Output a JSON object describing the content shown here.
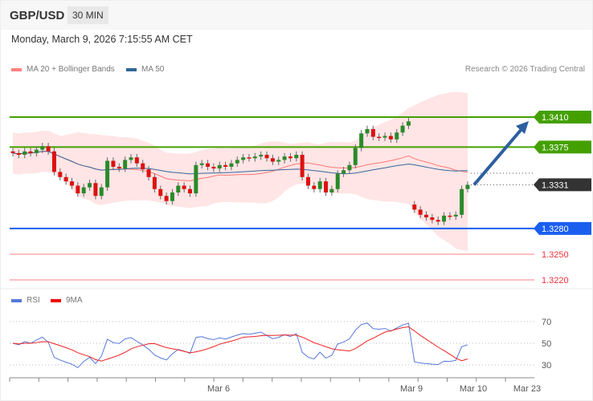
{
  "header": {
    "pair": "GBP/USD",
    "timeframe": "30 MIN",
    "datetime": "Monday, March 9, 2026 7:15:55 AM CET"
  },
  "legend": {
    "ma20": "MA 20 + Bollinger Bands",
    "ma50": "MA 50",
    "rsi": "RSI",
    "rsi_ma": "9MA"
  },
  "credit": "Research © 2026 Trading Central",
  "colors": {
    "resistance": "#44a000",
    "support": "#1a5ef0",
    "current": "#333333",
    "target_low": "#f0303a",
    "ma20": "#ff7777",
    "ma50": "#336699",
    "rsi": "#5577dd",
    "rsi_ma": "#ee2222",
    "up": "#2a8a2a",
    "down": "#dd1111"
  },
  "chart_data": {
    "type": "candlestick",
    "levels": [
      {
        "label": "1.3410",
        "value": 1.341,
        "kind": "resistance"
      },
      {
        "label": "1.3375",
        "value": 1.3375,
        "kind": "resistance"
      },
      {
        "label": "1.3331",
        "value": 1.3331,
        "kind": "current"
      },
      {
        "label": "1.3280",
        "value": 1.328,
        "kind": "support"
      },
      {
        "label": "1.3250",
        "value": 1.325,
        "kind": "target"
      },
      {
        "label": "1.3220",
        "value": 1.322,
        "kind": "target"
      }
    ],
    "closes": [
      1.3368,
      1.3366,
      1.337,
      1.3368,
      1.3372,
      1.3376,
      1.337,
      1.3346,
      1.334,
      1.3335,
      1.333,
      1.3321,
      1.3328,
      1.3333,
      1.3318,
      1.3328,
      1.3359,
      1.3352,
      1.335,
      1.336,
      1.3363,
      1.3356,
      1.3349,
      1.334,
      1.3326,
      1.3318,
      1.3312,
      1.3322,
      1.333,
      1.3326,
      1.3321,
      1.3354,
      1.3356,
      1.3352,
      1.335,
      1.3354,
      1.3352,
      1.3356,
      1.336,
      1.3363,
      1.3362,
      1.3364,
      1.3366,
      1.3362,
      1.3358,
      1.336,
      1.3364,
      1.3362,
      1.3366,
      1.334,
      1.333,
      1.3326,
      1.3335,
      1.3322,
      1.3326,
      1.3344,
      1.3348,
      1.3354,
      1.3374,
      1.3391,
      1.3396,
      1.3387,
      1.3386,
      1.3388,
      1.3384,
      1.3392,
      1.34,
      1.3405,
      1.3302,
      1.3296,
      1.3293,
      1.329,
      1.3288,
      1.3295,
      1.3294,
      1.3296,
      1.3326,
      1.3331
    ],
    "forecast_arrow": {
      "from": 1.3331,
      "to": 1.341
    },
    "rsi_ticks": [
      70,
      50,
      30
    ],
    "x_labels": [
      "Mar 6",
      "Mar 9",
      "Mar 10",
      "Mar 23"
    ]
  }
}
